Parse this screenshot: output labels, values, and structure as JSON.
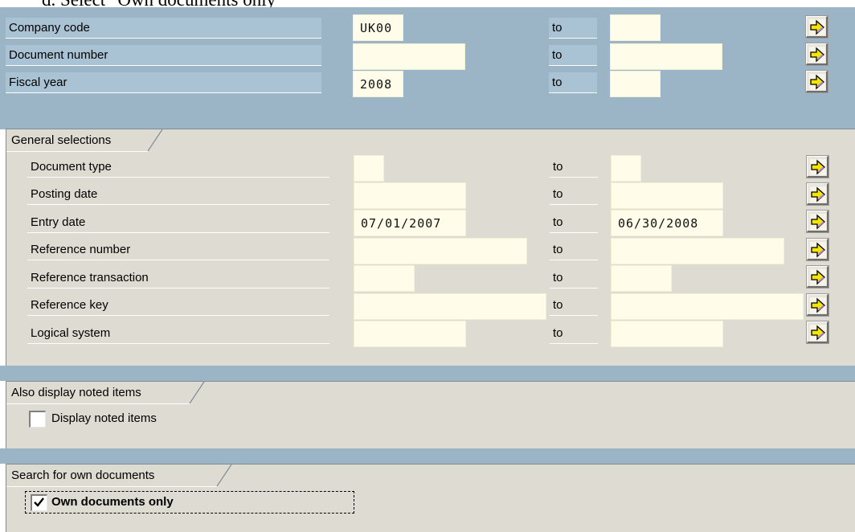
{
  "doc_heading": "d.   Select \"Own documents only\"",
  "to_label": "to",
  "top_fields": [
    {
      "label": "Company code",
      "from": "UK00",
      "to": ""
    },
    {
      "label": "Document number",
      "from": "",
      "to": ""
    },
    {
      "label": "Fiscal year",
      "from": "2008",
      "to": ""
    }
  ],
  "general_selections": {
    "title": "General selections",
    "rows": [
      {
        "label": "Document type",
        "from": "",
        "to": ""
      },
      {
        "label": "Posting date",
        "from": "",
        "to": ""
      },
      {
        "label": "Entry date",
        "from": "07/01/2007",
        "to": "06/30/2008"
      },
      {
        "label": "Reference number",
        "from": "",
        "to": ""
      },
      {
        "label": "Reference transaction",
        "from": "",
        "to": ""
      },
      {
        "label": "Reference key",
        "from": "",
        "to": ""
      },
      {
        "label": "Logical system",
        "from": "",
        "to": ""
      }
    ]
  },
  "noted_items": {
    "title": "Also display noted items",
    "checkbox_label": "Display noted items",
    "checked": false
  },
  "own_documents": {
    "title": "Search for own documents",
    "checkbox_label": "Own documents only",
    "checked": true
  },
  "icons": {
    "multiple_selection": "multiple-selection-arrow-icon",
    "check": "checkmark-icon"
  },
  "colors": {
    "screen_blue": "#9bb5c7",
    "group_bg": "#dedcd2",
    "input_bg": "#fffde9",
    "arrow_yellow": "#f5e600",
    "arrow_purple": "#b88ad4"
  }
}
